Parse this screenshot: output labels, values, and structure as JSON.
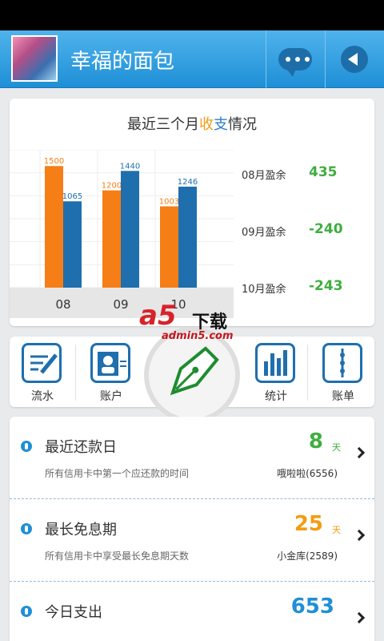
{
  "app": {
    "title": "幸福的面包"
  },
  "icons": {
    "avatar": "avatar-image",
    "chat": "chat-bubble-icon",
    "back": "back-arrow-icon"
  },
  "summary": {
    "title_prefix": "最近三个月",
    "title_in": "收",
    "title_out": "支",
    "title_suffix": "情况",
    "balances": [
      {
        "label": "08月盈余",
        "value": "435"
      },
      {
        "label": "09月盈余",
        "value": "-240"
      },
      {
        "label": "10月盈余",
        "value": "-243"
      }
    ]
  },
  "chart_data": {
    "type": "bar",
    "categories": [
      "08",
      "09",
      "10"
    ],
    "series": [
      {
        "values": [
          1500,
          1200,
          1003
        ],
        "color": "#f57e16"
      },
      {
        "values": [
          1065,
          1440,
          1246
        ],
        "color": "#1f6fae"
      }
    ],
    "ylim": [
      0,
      1700
    ],
    "grid": true
  },
  "tools": [
    {
      "label": "流水",
      "icon": "notepad-pencil-icon"
    },
    {
      "label": "账户",
      "icon": "id-card-icon"
    },
    {
      "label": "统计",
      "icon": "bar-chart-icon"
    },
    {
      "label": "账单",
      "icon": "ledger-icon"
    }
  ],
  "center_action": {
    "icon": "fountain-pen-icon"
  },
  "watermark": {
    "logo": "a5",
    "download": "下载",
    "url": "admin5.com"
  },
  "rows": [
    {
      "title": "最近还款日",
      "subtitle": "所有信用卡中第一个应还款的时间",
      "value": "8",
      "unit": "天",
      "who": "哦啦啦(6556)",
      "color": "#3fae3f"
    },
    {
      "title": "最长免息期",
      "subtitle": "所有信用卡中享受最长免息期天数",
      "value": "25",
      "unit": "天",
      "who": "小金库(2589)",
      "color": "#f39c12"
    },
    {
      "title": "今日支出",
      "value": "653",
      "color": "#1f8fd6"
    }
  ]
}
